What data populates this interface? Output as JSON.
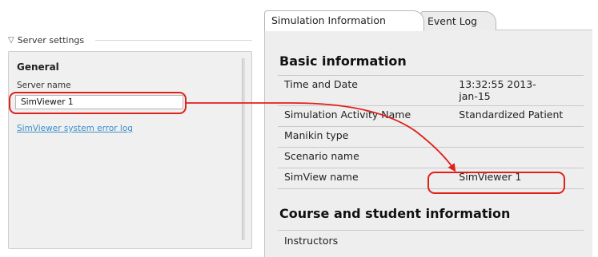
{
  "left_panel": {
    "section_label": "Server settings",
    "section_icon": "collapse-triangle-icon",
    "group_title": "General",
    "server_name_label": "Server name",
    "server_name_value": "SimViewer 1",
    "error_log_link": "SimViewer system error log"
  },
  "tabs": [
    {
      "label": "Simulation Information",
      "active": true
    },
    {
      "label": "Event Log",
      "active": false
    }
  ],
  "basic_info": {
    "title": "Basic information",
    "rows": [
      {
        "label": "Time and Date",
        "value": "13:32:55 2013-\njan-15"
      },
      {
        "label": "Simulation Activity Name",
        "value": "Standardized Patient"
      },
      {
        "label": "Manikin type",
        "value": ""
      },
      {
        "label": "Scenario name",
        "value": ""
      },
      {
        "label": "SimView name",
        "value": "SimViewer 1"
      }
    ]
  },
  "course_info": {
    "title": "Course and student information",
    "rows": [
      {
        "label": "Instructors",
        "value": ""
      }
    ]
  },
  "annotation": {
    "color": "#e0201b"
  }
}
